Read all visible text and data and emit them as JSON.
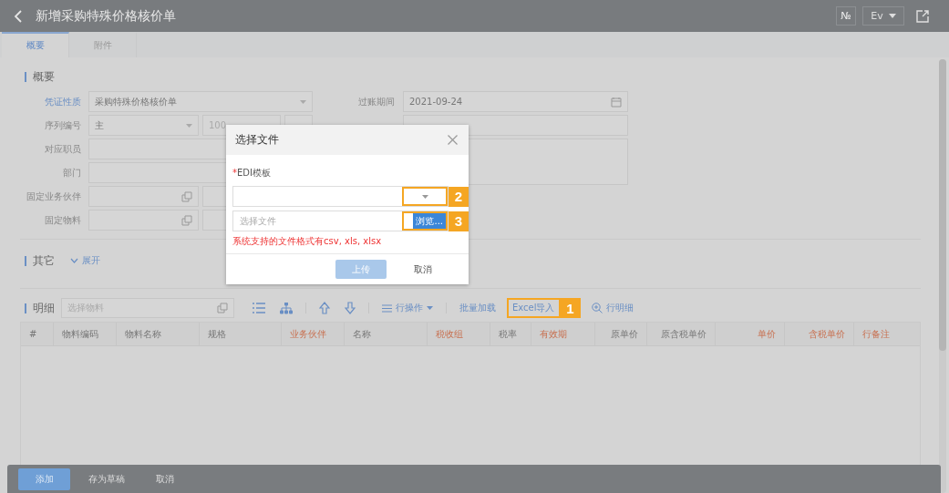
{
  "header": {
    "title": "新增采购特殊价格核价单",
    "number_button": "№",
    "language": "Ev"
  },
  "tabs": [
    {
      "label": "概要",
      "selected": true
    },
    {
      "label": "附件",
      "selected": false
    }
  ],
  "summary": {
    "title": "概要",
    "left_fields": [
      {
        "label": "凭证性质",
        "link": true,
        "kind": "select",
        "value": "采购特殊价格核价单"
      },
      {
        "label": "序列编号",
        "link": false,
        "kind": "sequence",
        "value": "主",
        "number": "100"
      },
      {
        "label": "对应职员",
        "link": false,
        "kind": "text"
      },
      {
        "label": "部门",
        "link": false,
        "kind": "text"
      },
      {
        "label": "固定业务伙伴",
        "link": false,
        "kind": "lookup"
      },
      {
        "label": "固定物料",
        "link": false,
        "kind": "lookup"
      }
    ],
    "right_fields": [
      {
        "label": "过账期间",
        "kind": "date",
        "value": "2021-09-24"
      },
      {
        "kind": "text"
      },
      {
        "kind": "textarea"
      }
    ]
  },
  "other": {
    "title": "其它",
    "toggle": "展开"
  },
  "detail": {
    "title": "明细",
    "search": {
      "placeholder": "选择物料"
    },
    "toolbar": [
      {
        "kind": "list"
      },
      {
        "kind": "tree"
      },
      {
        "kind": "sep"
      },
      {
        "kind": "up"
      },
      {
        "kind": "down"
      },
      {
        "kind": "sep"
      },
      {
        "kind": "menu",
        "label": "行操作"
      },
      {
        "kind": "sep"
      },
      {
        "kind": "link",
        "label": "批量加载"
      },
      {
        "kind": "link",
        "label": "Excel导入",
        "callout": "1"
      },
      {
        "kind": "zoom",
        "label": "行明细"
      }
    ],
    "columns": [
      {
        "label": "#",
        "required": false
      },
      {
        "label": "物料编码",
        "required": false
      },
      {
        "label": "物料名称",
        "required": false
      },
      {
        "label": "规格",
        "required": false
      },
      {
        "label": "业务伙伴",
        "required": true
      },
      {
        "label": "名称",
        "required": false
      },
      {
        "label": "税收组",
        "required": true
      },
      {
        "label": "税率",
        "required": false
      },
      {
        "label": "有效期",
        "required": true
      },
      {
        "label": "原单价",
        "required": false
      },
      {
        "label": "原含税单价",
        "required": false
      },
      {
        "label": "单价",
        "required": true
      },
      {
        "label": "含税单价",
        "required": true
      },
      {
        "label": "行备注",
        "required": true
      }
    ]
  },
  "footer": {
    "buttons": [
      {
        "label": "添加",
        "primary": true
      },
      {
        "label": "存为草稿",
        "primary": false
      },
      {
        "label": "取消",
        "primary": false
      }
    ]
  },
  "dialog": {
    "title": "选择文件",
    "required_mark": "*",
    "template_label": "EDI模板",
    "template_callout": "2",
    "file_placeholder": "选择文件",
    "browse": "浏览...",
    "browse_callout": "3",
    "hint": "系统支持的文件格式有csv, xls, xlsx",
    "buttons": [
      {
        "label": "上传",
        "primary": true
      },
      {
        "label": "取消",
        "primary": false
      }
    ]
  }
}
